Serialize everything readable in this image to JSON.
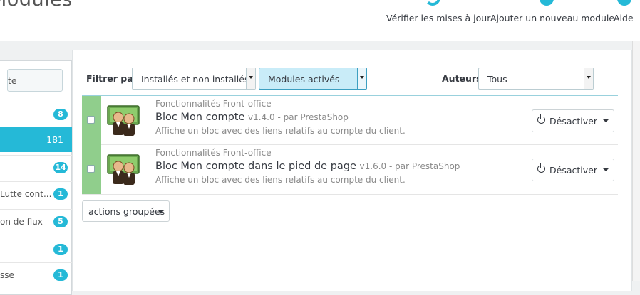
{
  "header": {
    "title": "Modules",
    "toolbar": [
      {
        "label": "Vérifier les mises à jour",
        "icon": "refresh-icon"
      },
      {
        "label": "Ajouter un nouveau module",
        "icon": "add-module-icon"
      },
      {
        "label": "Aide",
        "icon": "help-icon"
      }
    ]
  },
  "sidebar": {
    "search_value": "te",
    "items": [
      {
        "label": "",
        "count": "8",
        "active": false
      },
      {
        "label": "",
        "count": "181",
        "active": true
      },
      {
        "label": "",
        "count": "14",
        "active": false
      },
      {
        "label": "Lutte cont...",
        "count": "1",
        "active": false
      },
      {
        "label": "on de flux",
        "count": "5",
        "active": false
      },
      {
        "label": "",
        "count": "1",
        "active": false
      },
      {
        "label": "sse",
        "count": "1",
        "active": false
      }
    ]
  },
  "filters": {
    "filter_label": "Filtrer par",
    "install_select": "Installés et non installés",
    "status_select": "Modules activés",
    "authors_label": "Auteurs",
    "authors_select": "Tous"
  },
  "modules": [
    {
      "category": "Fonctionnalités Front-office",
      "name": "Bloc Mon compte",
      "version": "v1.4.0 - par PrestaShop",
      "description": "Affiche un bloc avec des liens relatifs au compte du client.",
      "action_label": "Désactiver"
    },
    {
      "category": "Fonctionnalités Front-office",
      "name": "Bloc Mon compte dans le pied de page",
      "version": "v1.6.0 - par PrestaShop",
      "description": "Affiche un bloc avec des liens relatifs au compte du client.",
      "action_label": "Désactiver"
    }
  ],
  "bulk_actions_label": "actions groupées",
  "colors": {
    "accent": "#25b9d7",
    "enabled_status": "#90ce8c",
    "highlight_select": "#c9ecf8"
  }
}
